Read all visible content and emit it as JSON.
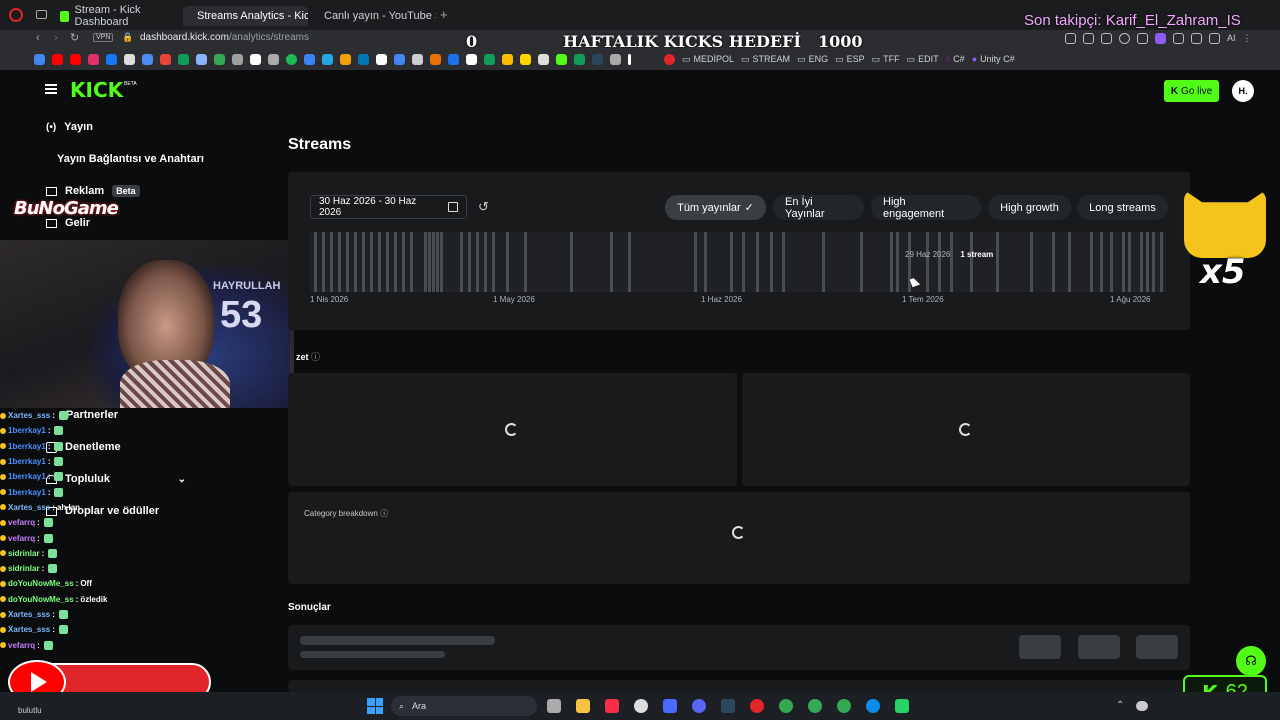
{
  "browser": {
    "tabs": [
      {
        "label": "Stream - Kick Dashboard"
      },
      {
        "label": "Streams Analytics - Kick D"
      },
      {
        "label": "Canlı yayın - YouTube Studi"
      }
    ],
    "vpn": "VPN",
    "url_domain": "dashboard.kick.com",
    "url_path": "/analytics/streams",
    "bookmarks": [
      "MEDİPOL",
      "STREAM",
      "ENG",
      "ESP",
      "TFF",
      "EDIT",
      "C#",
      "Unity C#"
    ],
    "ai_label": "AI"
  },
  "overlay": {
    "goal_current": "0",
    "goal_title": "HAFTALIK KICKS HEDEFİ",
    "goal_target": "1000",
    "last_follower": "Son takipçi: Karif_El_Zahram_IS",
    "brand": "BuNoGame",
    "cat_multiplier": "x5",
    "jersey_name": "HAYRULLAH",
    "jersey_number": "53",
    "kick_counter": "62",
    "yt_banner_text": "bulutlu"
  },
  "kick": {
    "logo": "KICK",
    "beta_badge": "BETA",
    "go_live": "Go live",
    "avatar_initials": "H.",
    "sidebar": [
      {
        "label": "Yayın"
      },
      {
        "label": "Yayın Bağlantısı ve Anahtarı"
      },
      {
        "label": "Reklam",
        "badge": "Beta"
      },
      {
        "label": "Gelir"
      },
      {
        "label": "Partnerler"
      },
      {
        "label": "Denetleme"
      },
      {
        "label": "Topluluk"
      },
      {
        "label": "Droplar ve ödüller"
      }
    ],
    "page_title": "Streams",
    "date_range": "30 Haz 2026 - 30 Haz 2026",
    "filters": [
      {
        "label": "Tüm yayınlar",
        "selected": true
      },
      {
        "label": "En İyi Yayınlar"
      },
      {
        "label": "High engagement"
      },
      {
        "label": "High growth"
      },
      {
        "label": "Long streams"
      }
    ],
    "timeline_ticks": [
      "1 Nis 2026",
      "1 May 2026",
      "1 Haz 2026",
      "1 Tem 2026",
      "1 Ağu 2026"
    ],
    "tooltip_date": "29 Haz 2026",
    "tooltip_value": "1 stream",
    "summary_label": "zet",
    "category_label": "Category breakdown",
    "results_label": "Sonuçlar"
  },
  "chat": [
    {
      "user": "Xartes_sss",
      "msg": "",
      "color": "#7ab8ff"
    },
    {
      "user": "1berrkay1",
      "msg": "",
      "color": "#4a90ff"
    },
    {
      "user": "1berrkay1",
      "msg": "",
      "color": "#4a90ff"
    },
    {
      "user": "1berrkay1",
      "msg": "",
      "color": "#4a90ff"
    },
    {
      "user": "1berrkay1",
      "msg": "",
      "color": "#4a90ff"
    },
    {
      "user": "1berrkay1",
      "msg": "",
      "color": "#4a90ff"
    },
    {
      "user": "Xartes_sss",
      "msg": "ah lan",
      "color": "#7ab8ff"
    },
    {
      "user": "vefarrq",
      "msg": "",
      "color": "#c77dff"
    },
    {
      "user": "vefarrq",
      "msg": "",
      "color": "#c77dff"
    },
    {
      "user": "sidrinlar",
      "msg": "",
      "color": "#7dff7d"
    },
    {
      "user": "sidrinlar",
      "msg": "",
      "color": "#7dff7d"
    },
    {
      "user": "doYouNowMe_ss",
      "msg": "Off",
      "color": "#7dff7d"
    },
    {
      "user": "doYouNowMe_ss",
      "msg": "özledik",
      "color": "#7dff7d"
    },
    {
      "user": "Xartes_sss",
      "msg": "",
      "color": "#7ab8ff"
    },
    {
      "user": "Xartes_sss",
      "msg": "",
      "color": "#7ab8ff"
    },
    {
      "user": "vefarrq",
      "msg": "",
      "color": "#c77dff"
    }
  ],
  "taskbar": {
    "search": "Ara"
  },
  "colors": {
    "kick_green": "#53fc18",
    "panel": "#181a1c",
    "bg": "#0b0c0d"
  }
}
